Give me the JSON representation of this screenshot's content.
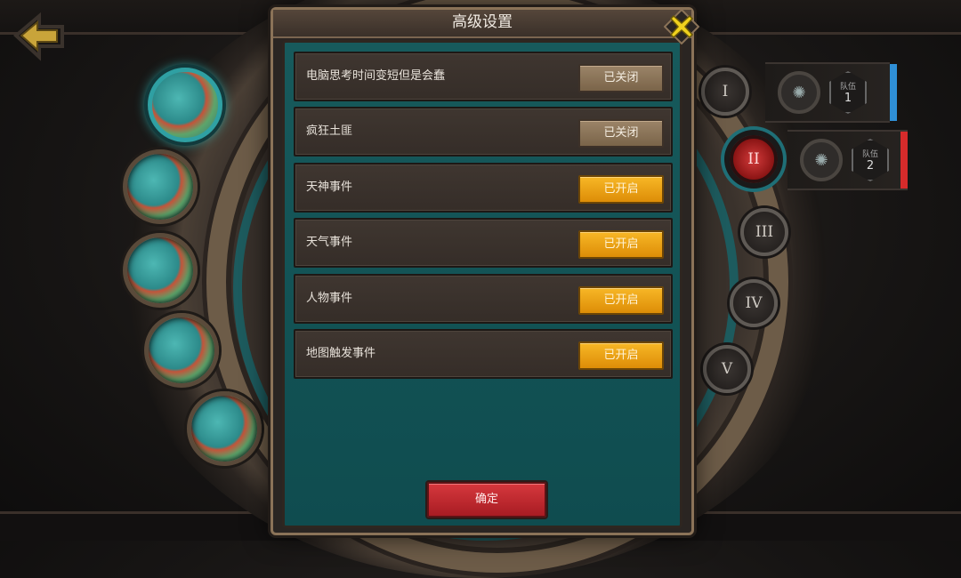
{
  "modal": {
    "title": "高级设置",
    "confirm_label": "确定",
    "settings": [
      {
        "label": "电脑思考时间变短但是会蠢",
        "state": "已关闭",
        "enabled": false
      },
      {
        "label": "疯狂土匪",
        "state": "已关闭",
        "enabled": false
      },
      {
        "label": "天神事件",
        "state": "已开启",
        "enabled": true
      },
      {
        "label": "天气事件",
        "state": "已开启",
        "enabled": true
      },
      {
        "label": "人物事件",
        "state": "已开启",
        "enabled": true
      },
      {
        "label": "地图触发事件",
        "state": "已开启",
        "enabled": true
      }
    ]
  },
  "wheel": {
    "roman_buttons": [
      "I",
      "II",
      "III",
      "IV",
      "V"
    ],
    "selected_roman": "II"
  },
  "teams": [
    {
      "label": "队伍",
      "number": "1",
      "color": "#2f8fd6"
    },
    {
      "label": "队伍",
      "number": "2",
      "color": "#d62b2b"
    }
  ],
  "colors": {
    "toggle_on": "#f2a816",
    "toggle_off": "#8a7357",
    "confirm": "#c62a31",
    "panel_teal": "#175a5c"
  },
  "icons": {
    "back": "back-arrow-icon",
    "close": "close-x-icon",
    "team_gear": "gear-icon"
  }
}
